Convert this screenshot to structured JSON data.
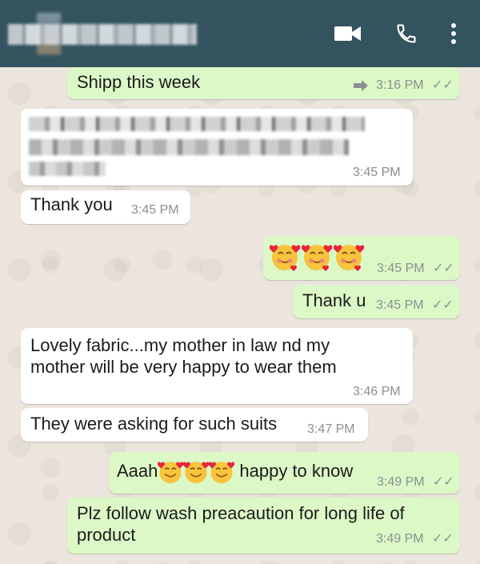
{
  "header": {
    "icons": [
      "video-call-icon",
      "phone-call-icon",
      "more-options-icon"
    ],
    "header_color": "#33545f"
  },
  "messages": [
    {
      "dir": "out",
      "text": "Shipp this week",
      "time": "3:16 PM",
      "ticks": "✓✓"
    },
    {
      "dir": "in",
      "text": "",
      "time": "3:45 PM",
      "redacted": true
    },
    {
      "dir": "in",
      "text": "Thank you",
      "time": "3:45 PM"
    },
    {
      "dir": "out",
      "text": "",
      "time": "3:45 PM",
      "ticks": "✓✓",
      "emoji": "smiling-face-with-hearts x3"
    },
    {
      "dir": "out",
      "text": "Thank u",
      "time": "3:45 PM",
      "ticks": "✓✓"
    },
    {
      "dir": "in",
      "text_line1": "Lovely fabric...my mother in law nd my",
      "text_line2": "mother will be very happy to wear them",
      "time": "3:46 PM"
    },
    {
      "dir": "in",
      "text": "They were asking for such suits",
      "time": "3:47 PM"
    },
    {
      "dir": "out",
      "text_part1": "Aaah",
      "text_part2": "happy to know",
      "time": "3:49 PM",
      "ticks": "✓✓",
      "emoji": "smiling-face-with-hearts x3"
    },
    {
      "dir": "out",
      "text_line1": "Plz follow wash preacaution for long life of",
      "text_line2": "product",
      "time": "3:49 PM",
      "ticks": "✓✓"
    }
  ],
  "colors": {
    "outgoing_bubble": "#dcf8c6",
    "incoming_bubble": "#ffffff",
    "wallpaper": "#ece5dd",
    "timestamp": "#8a8f93"
  }
}
